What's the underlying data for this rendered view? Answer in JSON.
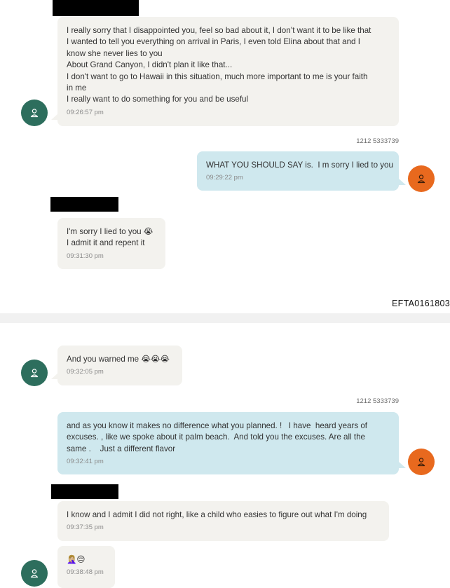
{
  "page_id": "EFTA0161803",
  "messages": {
    "m1": {
      "lines": [
        "I really sorry that I disappointed you, feel so bad about it, I don’t want it to be like that",
        "I wanted to tell you everything on arrival in Paris, I even told Elina about that and I",
        "know she never lies to you",
        "About Grand Canyon, I didn't plan it like that...",
        "I don't want to go to Hawaii in this situation, much more important to me is your faith",
        "in me",
        "I really want to do something for you and be useful"
      ],
      "time": "09:26:57 pm"
    },
    "m2": {
      "sender": "1212 5333739",
      "lines": [
        "WHAT YOU SHOULD SAY is.  I m sorry I lied to you"
      ],
      "time": "09:29:22 pm"
    },
    "m3": {
      "lines": [
        "I'm sorry I lied to you 😭",
        "I admit it and repent it"
      ],
      "time": "09:31:30 pm"
    },
    "m4": {
      "lines": [
        "And you warned me 😭😭😭"
      ],
      "time": "09:32:05 pm"
    },
    "m5": {
      "sender": "1212 5333739",
      "lines": [
        "and as you know it makes no difference what you planned. !   I have  heard years of",
        "excuses. , like we spoke about it palm beach.  And told you the excuses. Are all the",
        "same .    Just a different flavor"
      ],
      "time": "09:32:41 pm"
    },
    "m6": {
      "lines": [
        "I know and I admit I did not right, like a child who easies to figure out what I'm doing"
      ],
      "time": "09:37:35 pm"
    },
    "m7": {
      "lines": [
        "🤦🏼‍♀️😔"
      ],
      "time": "09:38:48 pm"
    }
  },
  "colors": {
    "incoming_bubble": "#f3f2ee",
    "outgoing_bubble": "#cfe8ee",
    "incoming_avatar": "#2d6e5d",
    "outgoing_avatar": "#e8691e"
  }
}
